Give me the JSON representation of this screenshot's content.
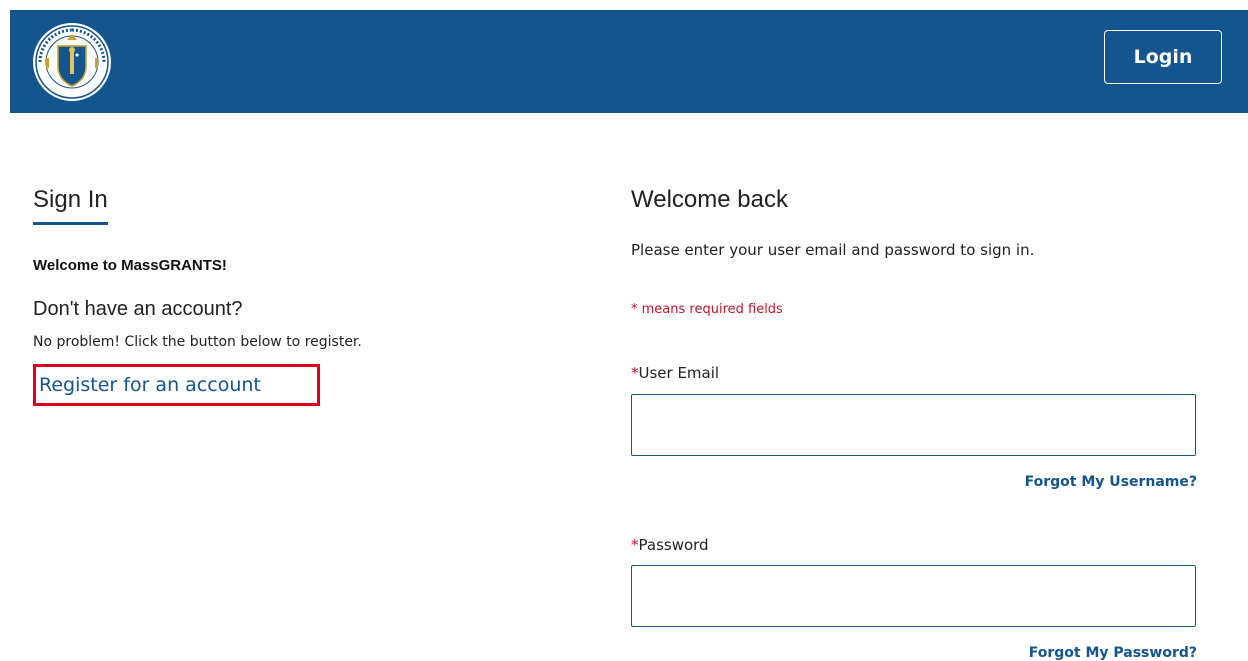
{
  "header": {
    "logo_icon": "massachusetts-seal-icon",
    "seal_text": "SIGILLUM REIPUBLICAE MASSACHUSETTENSIS",
    "login_label": "Login",
    "bg_color": "#14558f"
  },
  "signin": {
    "title": "Sign In",
    "welcome": "Welcome to MassGRANTS!",
    "no_account": "Don't have an account?",
    "no_problem": "No problem! Click the button below to register.",
    "register_link": "Register for an account"
  },
  "welcome_back": {
    "title": "Welcome back",
    "instructions": "Please enter your user email and password to sign in.",
    "required_note": "* means required fields",
    "email": {
      "star": "*",
      "label": "User Email",
      "value": "",
      "forgot_link": "Forgot My Username?"
    },
    "password": {
      "star": "*",
      "label": "Password",
      "value": "",
      "forgot_link": "Forgot My Password?"
    }
  },
  "colors": {
    "accent": "#14558f",
    "required": "#c0142c",
    "highlight": "#e0001b"
  }
}
